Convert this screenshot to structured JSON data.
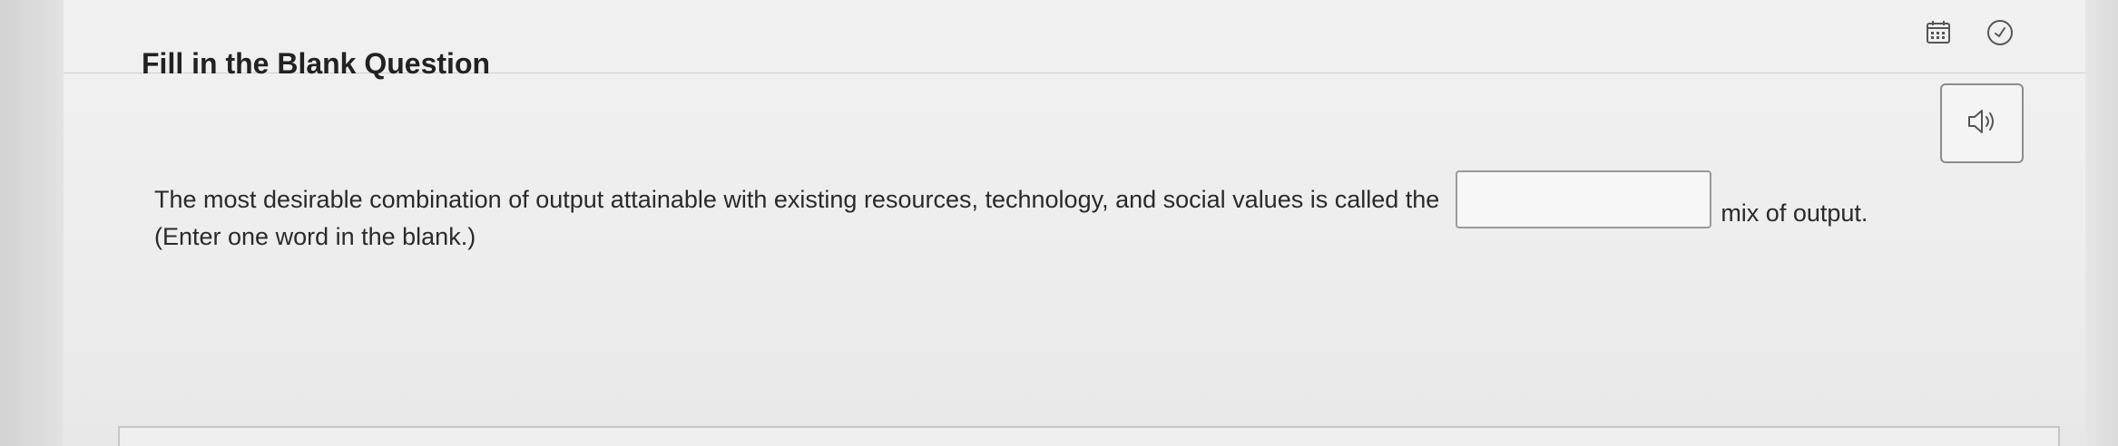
{
  "question": {
    "title": "Fill in the Blank Question",
    "text_before": "The most desirable combination of output attainable with existing resources, technology, and social values is called the",
    "blank_value": "",
    "text_after": "mix of output.",
    "hint": "(Enter one word in the blank.)"
  },
  "toolbar": {
    "icons": [
      "calculator-icon",
      "clock-icon"
    ],
    "audio_icon": "speaker-icon"
  },
  "colors": {
    "background": "#dcdcdc",
    "card": "#efefef",
    "border": "#9a9a9a",
    "text": "#2a2a2a"
  }
}
